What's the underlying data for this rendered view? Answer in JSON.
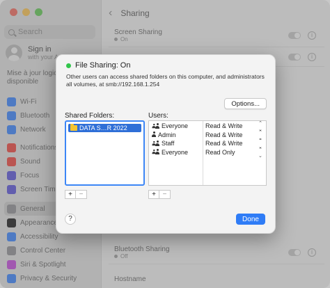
{
  "sidebar": {
    "search_placeholder": "Search",
    "profile": {
      "name": "Sign in",
      "subtitle": "with your A"
    },
    "update_text": "Mise à jour logiciel disponible",
    "group1": [
      {
        "label": "Wi-Fi",
        "icon": "wifi-icon",
        "color": "#3a82f7"
      },
      {
        "label": "Bluetooth",
        "icon": "bluetooth-icon",
        "color": "#3a82f7"
      },
      {
        "label": "Network",
        "icon": "globe-icon",
        "color": "#3a82f7"
      }
    ],
    "group2": [
      {
        "label": "Notifications",
        "icon": "bell-icon",
        "color": "#e9463f"
      },
      {
        "label": "Sound",
        "icon": "speaker-icon",
        "color": "#e9463f"
      },
      {
        "label": "Focus",
        "icon": "moon-icon",
        "color": "#5b55d6"
      },
      {
        "label": "Screen Time",
        "icon": "hourglass-icon",
        "color": "#5b55d6"
      }
    ],
    "group3": [
      {
        "label": "General",
        "icon": "gear-icon",
        "color": "#8e8e93"
      },
      {
        "label": "Appearance",
        "icon": "appearance-icon",
        "color": "#1c1c1e"
      },
      {
        "label": "Accessibility",
        "icon": "accessibility-icon",
        "color": "#3a82f7"
      },
      {
        "label": "Control Center",
        "icon": "control-center-icon",
        "color": "#8e8e93"
      },
      {
        "label": "Siri & Spotlight",
        "icon": "siri-icon",
        "color": "#c04bd8"
      },
      {
        "label": "Privacy & Security",
        "icon": "hand-icon",
        "color": "#3a82f7"
      }
    ]
  },
  "main": {
    "title": "Sharing",
    "rows": [
      {
        "label": "Screen Sharing",
        "status": "On"
      },
      {
        "label": "Bluetooth Sharing",
        "status": "Off"
      },
      {
        "label": "Hostname",
        "status": ""
      }
    ]
  },
  "sheet": {
    "title": "File Sharing: On",
    "description": "Other users can access shared folders on this computer, and administrators all volumes, at smb://192.168.1.254",
    "options_label": "Options...",
    "shared_folders_label": "Shared Folders:",
    "users_label": "Users:",
    "folders": [
      "DATA S…R 2022"
    ],
    "users": [
      {
        "name": "Everyone",
        "icon": "group-icon",
        "permission": "Read & Write"
      },
      {
        "name": "Admin",
        "icon": "person-icon",
        "permission": "Read & Write"
      },
      {
        "name": "Staff",
        "icon": "group-icon",
        "permission": "Read & Write"
      },
      {
        "name": "Everyone",
        "icon": "group-icon",
        "permission": "Read Only"
      }
    ],
    "add_label": "+",
    "remove_label": "−",
    "help_label": "?",
    "done_label": "Done",
    "accent_color": "#2f7cf6",
    "status_color": "#31c54b"
  }
}
